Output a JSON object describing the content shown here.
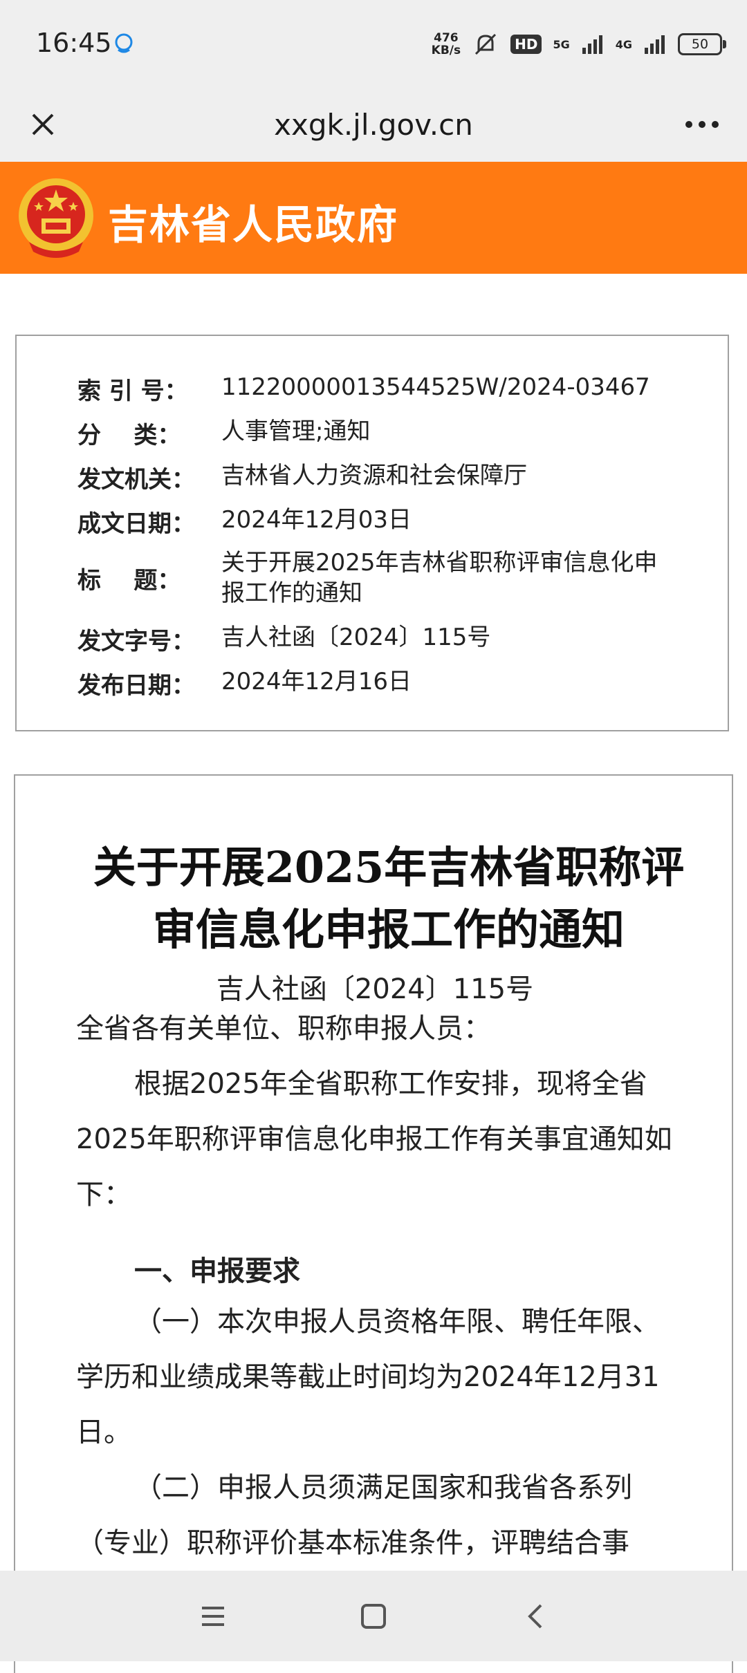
{
  "status_bar": {
    "time": "16:45",
    "speed_value": "476",
    "speed_unit": "KB/s",
    "hd_label": "HD",
    "net1": "5G",
    "net2": "4G",
    "battery": "50"
  },
  "browser": {
    "url": "xxgk.jl.gov.cn",
    "close_icon": "close-icon",
    "more_icon": "more-icon"
  },
  "site": {
    "name": "吉林省人民政府",
    "accent_color": "#ff7a12"
  },
  "meta": {
    "rows": [
      {
        "label": "索 引 号：",
        "value": "11220000013544525W/2024-03467"
      },
      {
        "label": "分    类：",
        "value": "人事管理;通知"
      },
      {
        "label": "发文机关：",
        "value": "吉林省人力资源和社会保障厅"
      },
      {
        "label": "成文日期：",
        "value": "2024年12月03日"
      },
      {
        "label": "标    题：",
        "value": "关于开展2025年吉林省职称评审信息化申报工作的通知"
      },
      {
        "label": "发文字号：",
        "value": "吉人社函〔2024〕115号"
      },
      {
        "label": "发布日期：",
        "value": "2024年12月16日"
      }
    ]
  },
  "article": {
    "title": "关于开展2025年吉林省职称评审信息化申报工作的通知",
    "doc_number": "吉人社函〔2024〕115号",
    "salutation": "全省各有关单位、职称申报人员：",
    "intro": "根据2025年全省职称工作安排，现将全省2025年职称评审信息化申报工作有关事宜通知如下：",
    "section1_heading": "一、申报要求",
    "item1": "（一）本次申报人员资格年限、聘任年限、学历和业绩成果等截止时间均为2024年12月31日。",
    "item2": "（二）申报人员须满足国家和我省各系列（专业）职称评价基本标准条件，评聘结合事"
  },
  "navbar": {
    "menu_icon": "menu-icon",
    "home_icon": "home-icon",
    "back_icon": "back-icon"
  }
}
